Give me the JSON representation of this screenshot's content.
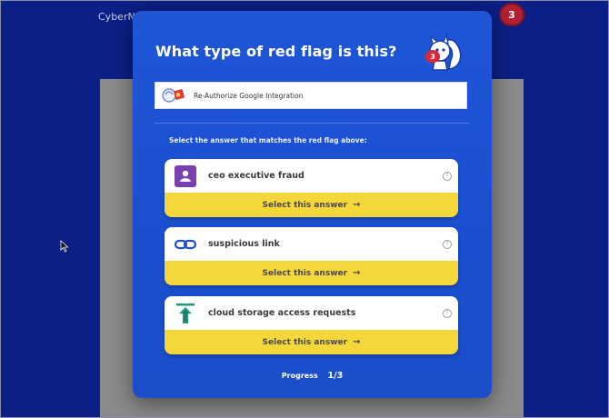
{
  "background": {
    "brand_text": "CyberN",
    "notification_count": "3"
  },
  "modal": {
    "title": "What type of red flag is this?",
    "mascot_badge": "3",
    "email_subject": "Re-Authorize Google Integration",
    "instruction": "Select the answer that matches the red flag above:",
    "answers": [
      {
        "label": "ceo executive fraud",
        "select_label": "Select this answer",
        "arrow": "→",
        "help": "?",
        "icon": "ceo-person-icon"
      },
      {
        "label": "suspicious link",
        "select_label": "Select this answer",
        "arrow": "→",
        "help": "?",
        "icon": "link-chain-icon"
      },
      {
        "label": "cloud storage access requests",
        "select_label": "Select this answer",
        "arrow": "→",
        "help": "?",
        "icon": "upload-arrow-icon"
      }
    ],
    "progress_label": "Progress",
    "progress_value": "1/3"
  },
  "colors": {
    "page_bg": "#0b1f86",
    "modal_bg": "#1f56d6",
    "select_bar": "#f5d73b",
    "ceo_icon": "#7b3fb0",
    "link_icon": "#1e4fc4",
    "upload_icon": "#1a9e7a"
  }
}
